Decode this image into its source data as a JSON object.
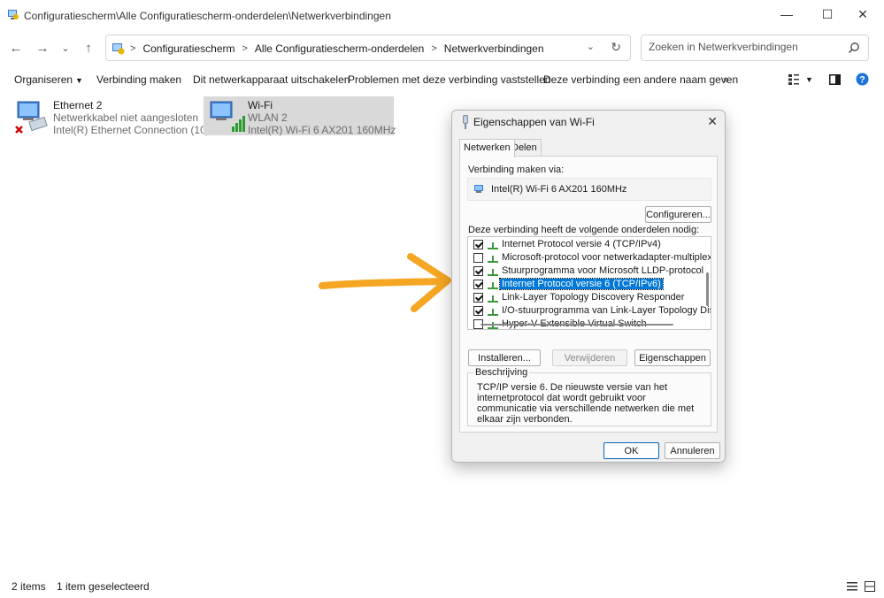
{
  "window": {
    "title": "Configuratiescherm\\Alle Configuratiescherm-onderdelen\\Netwerkverbindingen",
    "minimize": "—",
    "maximize": "☐",
    "close": "✕"
  },
  "address": {
    "crumbs": [
      "Configuratiescherm",
      "Alle Configuratiescherm-onderdelen",
      "Netwerkverbindingen"
    ],
    "search_placeholder": "Zoeken in Netwerkverbindingen"
  },
  "commands": {
    "organize": "Organiseren",
    "connect": "Verbinding maken",
    "disable": "Dit netwerkapparaat uitschakelen",
    "diagnose": "Problemen met deze verbinding vaststellen",
    "rename": "Deze verbinding een andere naam geven",
    "more": "»"
  },
  "connections": [
    {
      "name": "Ethernet 2",
      "status": "Netwerkkabel niet aangesloten",
      "adapter": "Intel(R) Ethernet Connection (10) ...",
      "selected": false
    },
    {
      "name": "Wi-Fi",
      "status": "WLAN 2",
      "adapter": "Intel(R) Wi-Fi 6 AX201 160MHz",
      "selected": true
    }
  ],
  "statusbar": {
    "count": "2 items",
    "selected": "1 item geselecteerd"
  },
  "dialog": {
    "title": "Eigenschappen van Wi-Fi",
    "tabs": [
      "Netwerken",
      "Delen"
    ],
    "connect_via_label": "Verbinding maken via:",
    "adapter": "Intel(R) Wi-Fi 6 AX201 160MHz",
    "configure_button": "Configureren...",
    "components_label": "Deze verbinding heeft de volgende onderdelen nodig:",
    "components": [
      {
        "label": "Internet Protocol versie 4 (TCP/IPv4)",
        "checked": true,
        "selected": false
      },
      {
        "label": "Microsoft-protocol voor netwerkadapter-multiplexor",
        "checked": false,
        "selected": false
      },
      {
        "label": "Stuurprogramma voor Microsoft LLDP-protocol",
        "checked": true,
        "selected": false
      },
      {
        "label": "Internet Protocol versie 6 (TCP/IPv6)",
        "checked": true,
        "selected": true
      },
      {
        "label": "Link-Layer Topology Discovery Responder",
        "checked": true,
        "selected": false
      },
      {
        "label": "I/O-stuurprogramma van Link-Layer Topology Discover",
        "checked": true,
        "selected": false
      },
      {
        "label": "Hyper-V Extensible Virtual Switch",
        "checked": false,
        "selected": false
      }
    ],
    "install_button": "Installeren...",
    "remove_button": "Verwijderen",
    "properties_button": "Eigenschappen",
    "description_title": "Beschrijving",
    "description_text": "TCP/IP versie 6. De nieuwste versie van het internetprotocol dat wordt gebruikt voor communicatie via verschillende netwerken die met elkaar zijn verbonden.",
    "ok_button": "OK",
    "cancel_button": "Annuleren"
  },
  "colors": {
    "accent": "#0078d7",
    "selection_gray": "#d9d9d9",
    "annotation_arrow": "#f5a623",
    "help_blue": "#1a73d9"
  }
}
